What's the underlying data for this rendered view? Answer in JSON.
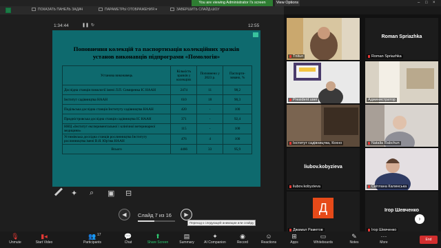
{
  "topbar": {
    "banner": "You are viewing Administrator I's screen",
    "view_options": "View Options",
    "colors": {
      "banner": "#2e7d32"
    }
  },
  "presenter_toolbar": {
    "show_taskbar": "ПОКАЗАТЬ ПАНЕЛЬ ЗАДАЧ",
    "display_settings": "ПАРАМЕТРЫ ОТОБРАЖЕНИЯ ▾",
    "end_slideshow": "ЗАВЕРШИТЬ СЛАЙД-ШОУ"
  },
  "presenter": {
    "elapsed": "1:34:44",
    "clock": "12:55",
    "slide_counter": "Слайд 7 из 16",
    "progress": 0.4375,
    "tooltip": "Переход к следующей анимации или слайду"
  },
  "slide": {
    "title": "Поповнення колекцій та паспортизація колекційних зразків установ виконавців підпрограми «Помологія»",
    "headers": [
      "Установа виконавець",
      "Кількість зразків у колекціях",
      "Поповнено у 2023 р.",
      "Паспорти-зовано, %"
    ],
    "rows": [
      [
        "Дослідна станція помології імені Л.П. Симиренка ІС НААН",
        "2474",
        "11",
        "98,2"
      ],
      [
        "Інститут садівництва НААН",
        "610",
        "18",
        "90,3"
      ],
      [
        "Подільська дослідна станція Інституту садівництва НААН",
        "420",
        "-",
        "100"
      ],
      [
        "Придністровська дослідна станція садівництва ІС НААН",
        "371",
        "-",
        "92,4"
      ],
      [
        "ННЦ «Інститут експериментальної і клінічної ветеринарної медицини»",
        "115",
        "-",
        "100"
      ],
      [
        "Устимівська дослідна станція рослинництва Інституту рослинництва імені В.Я. Юр'єва НААН",
        "476",
        "4",
        "100"
      ],
      [
        "Всього",
        "4466",
        "33",
        "95,9"
      ]
    ]
  },
  "gallery": [
    {
      "name": "Tnitun"
    },
    {
      "name": "Roman Spriazhka",
      "label": "Roman Spriazhka"
    },
    {
      "name": "President user"
    },
    {
      "name": "Администратор"
    },
    {
      "name": "Інститут садівництва, Кохно"
    },
    {
      "name": "Natalia Rabchun"
    },
    {
      "name": "liubov.kobyzieva",
      "label": "liubov.kobyzieva"
    },
    {
      "name": "Світлана Калинська"
    },
    {
      "name": "Джамал Раметов",
      "avatar": "Д"
    },
    {
      "name": "Ігор Шевченко",
      "label": "Ігор Шевченко"
    }
  ],
  "bottombar": {
    "unmute": "Unmute",
    "start_video": "Start Video",
    "participants": "Participants",
    "participants_count": "17",
    "chat": "Chat",
    "share_screen": "Share Screen",
    "summary": "Summary",
    "ai_companion": "AI Companion",
    "record": "Record",
    "reactions": "Reactions",
    "apps": "Apps",
    "whiteboards": "Whiteboards",
    "notes": "Notes",
    "more": "More",
    "end": "End"
  }
}
